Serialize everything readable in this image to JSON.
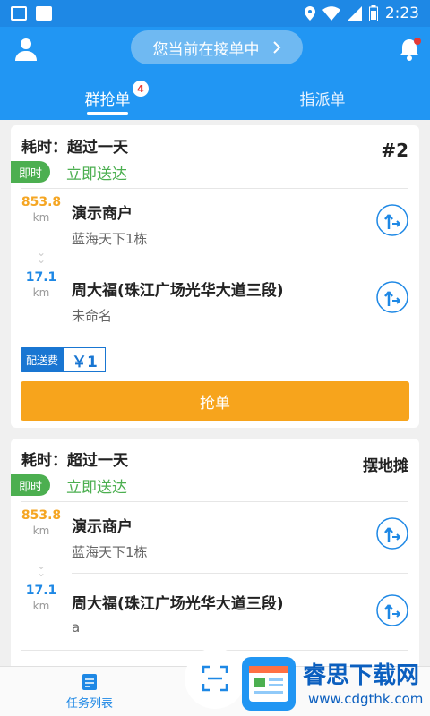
{
  "status_bar": {
    "time": "2:23"
  },
  "header": {
    "status_pill": "您当前在接单中",
    "tabs": [
      {
        "label": "群抢单",
        "badge": "4",
        "active": true
      },
      {
        "label": "指派单",
        "active": false
      }
    ]
  },
  "orders": [
    {
      "time_label": "耗时：超过一天",
      "tag": "即时",
      "delivery": "立即送达",
      "corner": "#2",
      "pickup": {
        "distance": "853.8",
        "unit": "km",
        "name": "演示商户",
        "address": "蓝海天下1栋"
      },
      "dropoff": {
        "distance": "17.1",
        "unit": "km",
        "name": "周大福(珠江广场光华大道三段)",
        "address": "未命名"
      },
      "fee_label": "配送费",
      "fee_value": "￥1",
      "grab_label": "抢单"
    },
    {
      "time_label": "耗时：超过一天",
      "tag": "即时",
      "delivery": "立即送达",
      "corner": "摆地摊",
      "pickup": {
        "distance": "853.8",
        "unit": "km",
        "name": "演示商户",
        "address": "蓝海天下1栋"
      },
      "dropoff": {
        "distance": "17.1",
        "unit": "km",
        "name": "周大福(珠江广场光华大道三段)",
        "address": "a"
      }
    }
  ],
  "bottom_nav": {
    "task_list": "任务列表"
  },
  "watermark": {
    "title": "睿思下载网",
    "url": "www.cdgthk.com"
  },
  "colors": {
    "primary": "#2196f3",
    "accent": "#f7a41c",
    "green": "#4caf50"
  }
}
